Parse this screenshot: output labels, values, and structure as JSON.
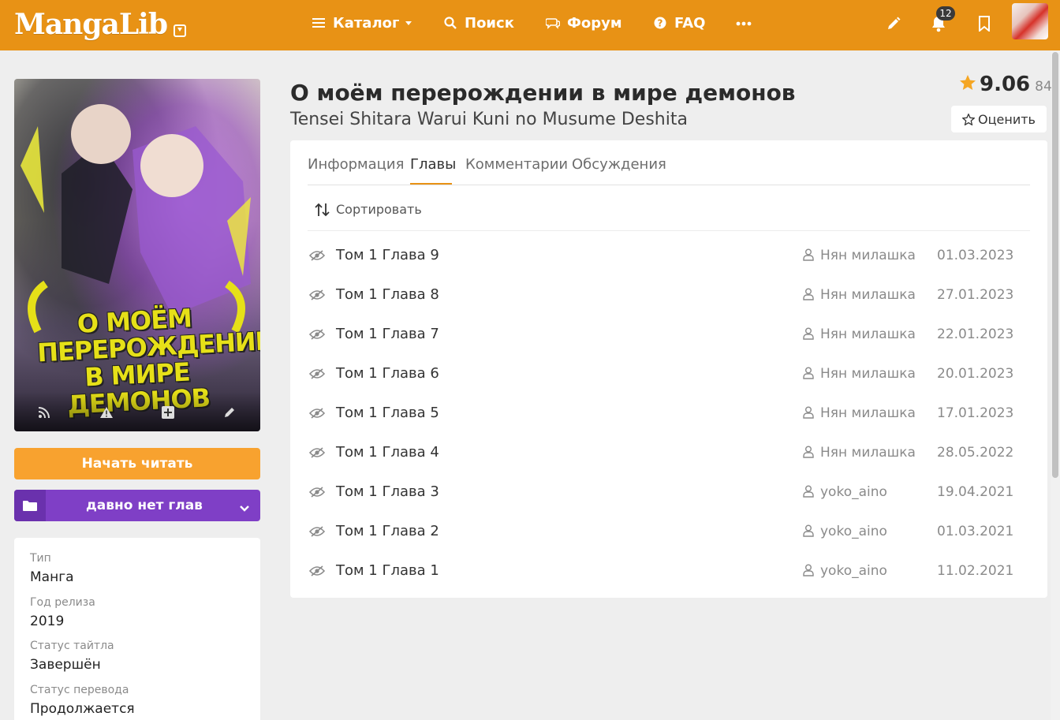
{
  "header": {
    "logo": "MangaLib",
    "nav": [
      {
        "label": "Каталог",
        "icon": "menu-icon"
      },
      {
        "label": "Поиск",
        "icon": "search-icon"
      },
      {
        "label": "Форум",
        "icon": "chat-icon"
      },
      {
        "label": "FAQ",
        "icon": "help-icon"
      }
    ],
    "notifications_count": "12",
    "accent_color": "#e89215"
  },
  "cover": {
    "title_art": "О МОЁМ ПЕРЕРОЖДЕНИИ В МИРЕ ДЕМОНОВ"
  },
  "actions": {
    "start_reading": "Начать читать",
    "list_status": "давно нет глав"
  },
  "info": [
    {
      "label": "Тип",
      "value": "Манга"
    },
    {
      "label": "Год релиза",
      "value": "2019"
    },
    {
      "label": "Статус тайтла",
      "value": "Завершён"
    },
    {
      "label": "Статус перевода",
      "value": "Продолжается"
    }
  ],
  "manga": {
    "title": "О моём перерождении в мире демонов",
    "subtitle": "Tensei Shitara Warui Kuni no Musume Deshita",
    "rating": "9.06",
    "rating_count": "84",
    "rate_button": "Оценить"
  },
  "tabs": [
    {
      "label": "Информация",
      "active": false
    },
    {
      "label": "Главы",
      "active": true
    },
    {
      "label": "Комментарии",
      "active": false
    },
    {
      "label": "Обсуждения",
      "active": false
    }
  ],
  "sort_label": "Сортировать",
  "chapters": [
    {
      "title": "Том 1 Глава 9",
      "translator": "Нян милашка",
      "date": "01.03.2023"
    },
    {
      "title": "Том 1 Глава 8",
      "translator": "Нян милашка",
      "date": "27.01.2023"
    },
    {
      "title": "Том 1 Глава 7",
      "translator": "Нян милашка",
      "date": "22.01.2023"
    },
    {
      "title": "Том 1 Глава 6",
      "translator": "Нян милашка",
      "date": "20.01.2023"
    },
    {
      "title": "Том 1 Глава 5",
      "translator": "Нян милашка",
      "date": "17.01.2023"
    },
    {
      "title": "Том 1 Глава 4",
      "translator": "Нян милашка",
      "date": "28.05.2022"
    },
    {
      "title": "Том 1 Глава 3",
      "translator": "yoko_aino",
      "date": "19.04.2021"
    },
    {
      "title": "Том 1 Глава 2",
      "translator": "yoko_aino",
      "date": "01.03.2021"
    },
    {
      "title": "Том 1 Глава 1",
      "translator": "yoko_aino",
      "date": "11.02.2021"
    }
  ]
}
